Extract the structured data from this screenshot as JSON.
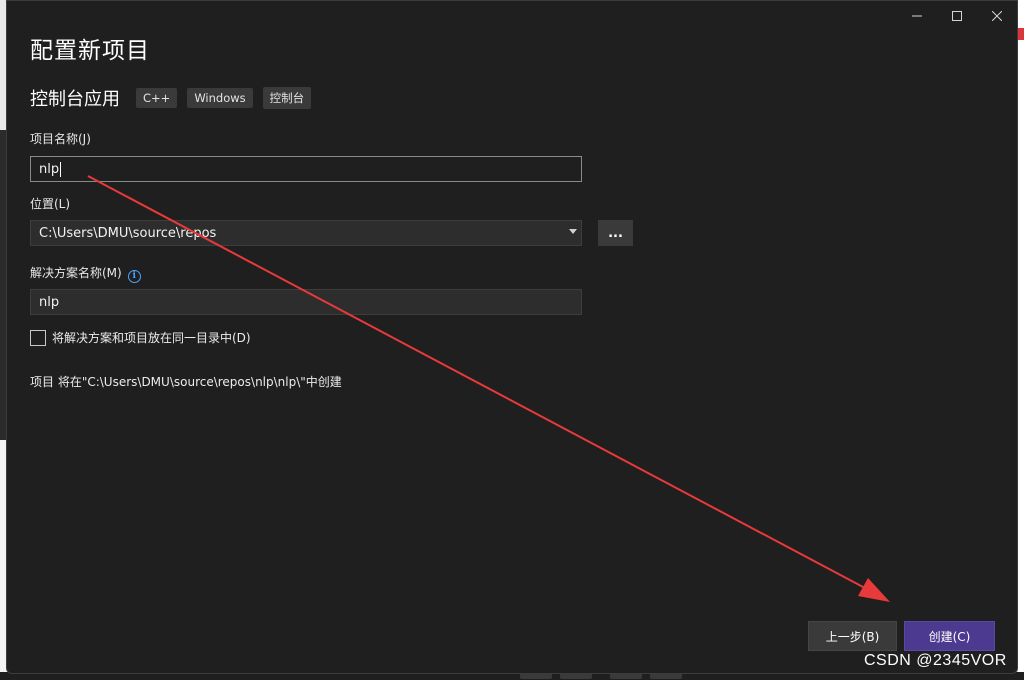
{
  "dialog": {
    "title": "配置新项目",
    "template": {
      "name": "控制台应用",
      "tags": [
        "C++",
        "Windows",
        "控制台"
      ]
    },
    "project_name": {
      "label": "项目名称(J)",
      "value": "nlp"
    },
    "location": {
      "label": "位置(L)",
      "value": "C:\\Users\\DMU\\source\\repos",
      "browse_label": "..."
    },
    "solution_name": {
      "label": "解决方案名称(M)",
      "value": "nlp",
      "info_glyph": "i"
    },
    "same_directory": {
      "label": "将解决方案和项目放在同一目录中(D)",
      "checked": false
    },
    "path_info": "项目 将在\"C:\\Users\\DMU\\source\\repos\\nlp\\nlp\\\"中创建",
    "buttons": {
      "back": "上一步(B)",
      "create": "创建(C)"
    },
    "window_controls": [
      "minimize-icon",
      "maximize-icon",
      "close-icon"
    ]
  },
  "annotation": {
    "color": "#e8393b"
  },
  "watermark": "CSDN @2345VOR",
  "colors": {
    "accent": "#4c3a90",
    "background": "#1f1f1f",
    "info": "#4ea2ff"
  }
}
